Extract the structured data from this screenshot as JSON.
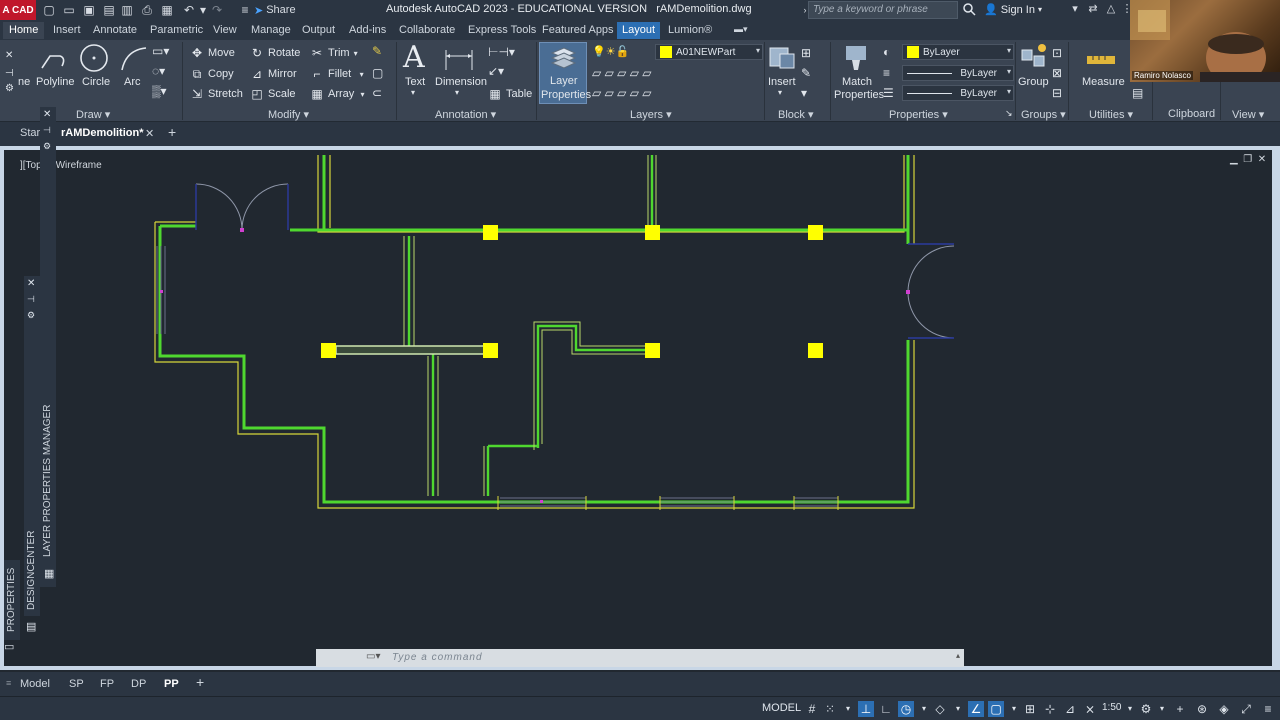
{
  "titlebar": {
    "app_badge": "A CAD",
    "share": "Share",
    "title": "Autodesk AutoCAD 2023 - EDUCATIONAL VERSION",
    "filename": "rAMDemolition.dwg",
    "search_placeholder": "Type a keyword or phrase",
    "signin": "Sign In"
  },
  "ribbon_tabs": [
    "Home",
    "Insert",
    "Annotate",
    "Parametric",
    "View",
    "Manage",
    "Output",
    "Add-ins",
    "Collaborate",
    "Express Tools",
    "Featured Apps",
    "Layout",
    "Lumion®"
  ],
  "ribbon": {
    "draw": {
      "title": "Draw",
      "polyline": "Polyline",
      "circle": "Circle",
      "arc": "Arc",
      "line_partial": "ne"
    },
    "modify": {
      "title": "Modify",
      "move": "Move",
      "rotate": "Rotate",
      "trim": "Trim",
      "copy": "Copy",
      "mirror": "Mirror",
      "fillet": "Fillet",
      "stretch": "Stretch",
      "scale": "Scale",
      "array": "Array"
    },
    "annotation": {
      "title": "Annotation",
      "text": "Text",
      "dimension": "Dimension",
      "table": "Table"
    },
    "layers": {
      "title": "Layers",
      "layer_properties_1": "Layer",
      "layer_properties_2": "Properties",
      "current_layer": "A01NEWPart"
    },
    "block": {
      "title": "Block",
      "insert": "Insert"
    },
    "properties": {
      "title": "Properties",
      "match_1": "Match",
      "match_2": "Properties",
      "color": "ByLayer",
      "linetype": "ByLayer",
      "lineweight": "ByLayer"
    },
    "groups": {
      "title": "Groups",
      "group": "Group"
    },
    "utilities": {
      "title": "Utilities",
      "measure": "Measure"
    },
    "clipboard": {
      "title": "Clipboard",
      "paste_partial": "Paste"
    },
    "view": {
      "title": "View"
    }
  },
  "webcam": {
    "name": "Ramiro Nolasco"
  },
  "doc_tabs": {
    "start_partial": "Start",
    "active": "rAMDemolition*",
    "plus": "+"
  },
  "viewport": {
    "label_a": "][Top",
    "label_b": "] Wireframe"
  },
  "palettes": {
    "layer_manager": "LAYER PROPERTIES MANAGER",
    "designcenter": "DESIGNCENTER",
    "properties": "PROPERTIES"
  },
  "command": {
    "placeholder": "Type a command"
  },
  "layout_tabs": [
    "Model",
    "SP",
    "FP",
    "DP",
    "PP"
  ],
  "layout_active": "PP",
  "status": {
    "model": "MODEL",
    "scale": "1:50"
  },
  "colors": {
    "wall": "#5be03a",
    "wall_outer": "#d9d93a",
    "column": "#ffff00",
    "door": "#1e2f8a",
    "background": "#212830"
  }
}
